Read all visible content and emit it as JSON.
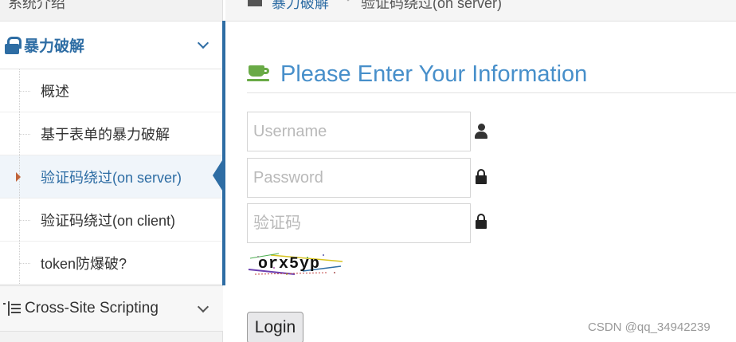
{
  "sidebar": {
    "cut_item_label": "系统介绍",
    "section_brute": {
      "title": "暴力破解",
      "icon": "lock-icon",
      "items": [
        {
          "label": "概述"
        },
        {
          "label": "基于表单的暴力破解"
        },
        {
          "label": "验证码绕过(on server)",
          "active": true
        },
        {
          "label": "验证码绕过(on client)"
        },
        {
          "label": "token防爆破?"
        }
      ]
    },
    "section_xss": {
      "title": "Cross-Site Scripting",
      "icon": "list-icon"
    }
  },
  "breadcrumb": {
    "home_icon": "home-icon",
    "link": "暴力破解",
    "current": "验证码绕过(on server)"
  },
  "page": {
    "icon": "coffee-cup-icon",
    "title": "Please Enter Your Information"
  },
  "form": {
    "username_placeholder": "Username",
    "password_placeholder": "Password",
    "captcha_placeholder": "验证码",
    "captcha_text": "orx5yp",
    "login_label": "Login"
  },
  "watermark": "CSDN @qq_34942239",
  "colors": {
    "accent": "#2e6da4",
    "title_blue": "#478fca",
    "green_icon": "#69aa46",
    "active_caret": "#c0643a"
  }
}
